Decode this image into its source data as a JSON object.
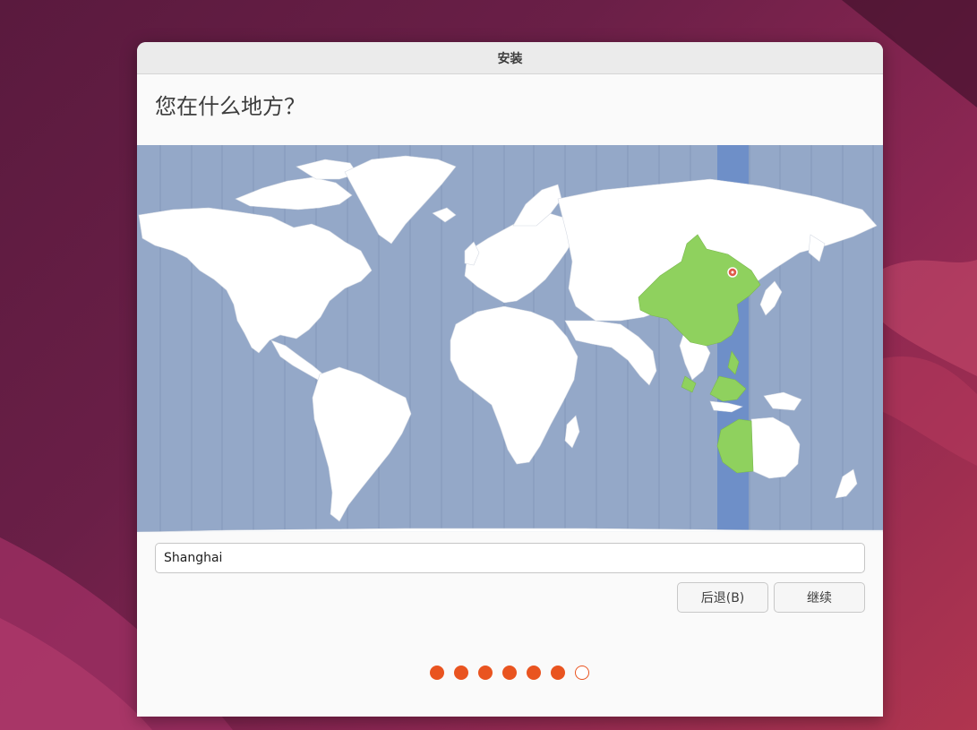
{
  "window": {
    "title": "安装"
  },
  "page": {
    "heading": "您在什么地方？"
  },
  "map": {
    "ocean_color": "#94a8c8",
    "land_color": "#ffffff",
    "selected_region_color": "#8fd15e",
    "selected_timezone_band_color": "#6e8fc8",
    "pin_icon": "location-pin-icon"
  },
  "location": {
    "value": "Shanghai"
  },
  "buttons": {
    "back_label": "后退(B)",
    "continue_label": "继续"
  },
  "progress": {
    "total_steps": 7,
    "completed_steps": 6,
    "accent_color": "#e95420"
  }
}
